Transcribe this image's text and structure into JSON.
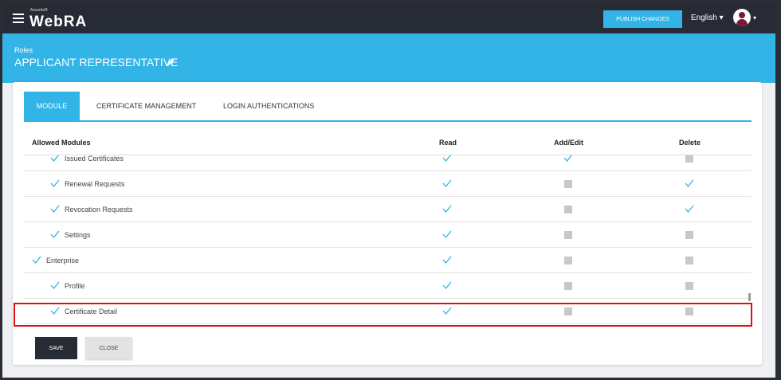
{
  "topbar": {
    "brand_sup": "Ascertia®",
    "brand_name": "WebRA",
    "publish_label": "PUBLISH CHANGES",
    "language": "English ▾",
    "avatar_caret": "▾"
  },
  "hero": {
    "section": "Roles",
    "title": "APPLICANT REPRESENTATIVE"
  },
  "tabs": [
    {
      "label": "MODULE",
      "active": true
    },
    {
      "label": "CERTIFICATE MANAGEMENT",
      "active": false
    },
    {
      "label": "LOGIN AUTHENTICATIONS",
      "active": false
    }
  ],
  "table": {
    "headers": {
      "module": "Allowed Modules",
      "read": "Read",
      "add_edit": "Add/Edit",
      "delete": "Delete"
    },
    "rows": [
      {
        "label": "Issued Certificates",
        "level": 2,
        "read": true,
        "add_edit": true,
        "delete": false
      },
      {
        "label": "Renewal Requests",
        "level": 2,
        "read": true,
        "add_edit": false,
        "delete": true
      },
      {
        "label": "Revocation Requests",
        "level": 2,
        "read": true,
        "add_edit": false,
        "delete": true
      },
      {
        "label": "Settings",
        "level": 2,
        "read": true,
        "add_edit": false,
        "delete": false
      },
      {
        "label": "Enterprise",
        "level": 1,
        "read": true,
        "add_edit": false,
        "delete": false
      },
      {
        "label": "Profile",
        "level": 2,
        "read": true,
        "add_edit": false,
        "delete": false
      },
      {
        "label": "Certificate Detail",
        "level": 2,
        "read": true,
        "add_edit": false,
        "delete": false
      }
    ]
  },
  "buttons": {
    "save": "SAVE",
    "close": "CLOSE"
  },
  "colors": {
    "accent": "#33b4e6",
    "topbar": "#262b35",
    "highlight": "#e01010",
    "check": "#33b4e6"
  }
}
